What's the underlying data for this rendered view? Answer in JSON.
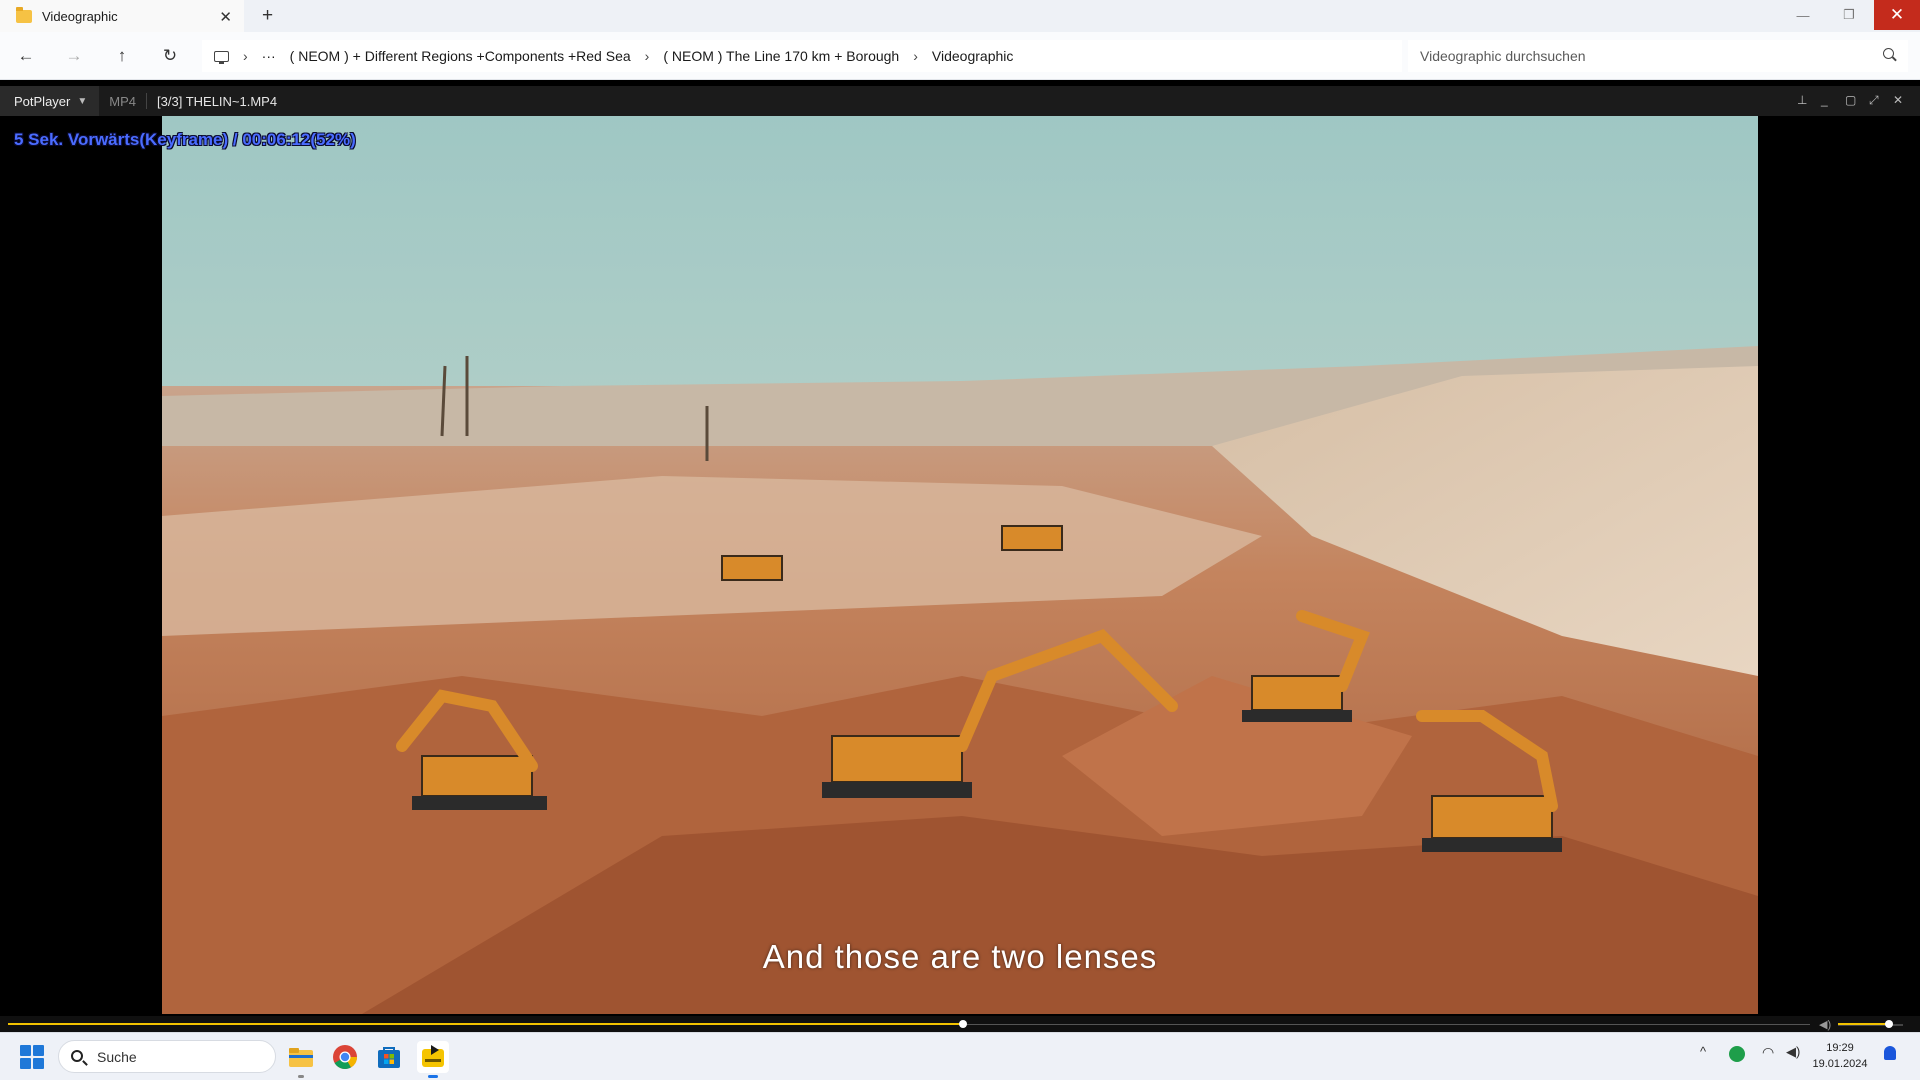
{
  "explorer": {
    "tab_title": "Videographic",
    "new_tab_symbol": "+",
    "close_tab_symbol": "✕",
    "window_controls": {
      "minimize": "—",
      "restore": "❐",
      "close": "✕"
    },
    "nav": {
      "back": "←",
      "forward": "→",
      "up": "↑",
      "refresh": "↻"
    },
    "breadcrumbs": {
      "overflow": "···",
      "items": [
        "( NEOM ) + Different Regions +Components +Red Sea",
        "( NEOM ) The Line 170 km + Borough",
        "Videographic"
      ],
      "separator": "›"
    },
    "search_placeholder": "Videographic durchsuchen"
  },
  "player": {
    "brand": "PotPlayer",
    "format": "MP4",
    "file": "[3/3] THELIN~1.MP4",
    "osd_text": "5  Sek. Vorwärts(Keyframe) / 00:06:12(52%)",
    "subtitle": "And those are two lenses",
    "progress_fraction": 0.53,
    "volume_fraction": 0.78,
    "colors": {
      "osd": "#4a6cff",
      "seek": "#f2c200"
    }
  },
  "taskbar": {
    "search_label": "Suche",
    "apps": [
      "file-explorer-icon",
      "chrome-icon",
      "microsoft-store-icon",
      "potplayer-icon"
    ],
    "tray": {
      "overflow": "^",
      "wifi": "wifi-icon",
      "volume": "speaker-icon"
    },
    "time": "19:29",
    "date": "19.01.2024"
  }
}
